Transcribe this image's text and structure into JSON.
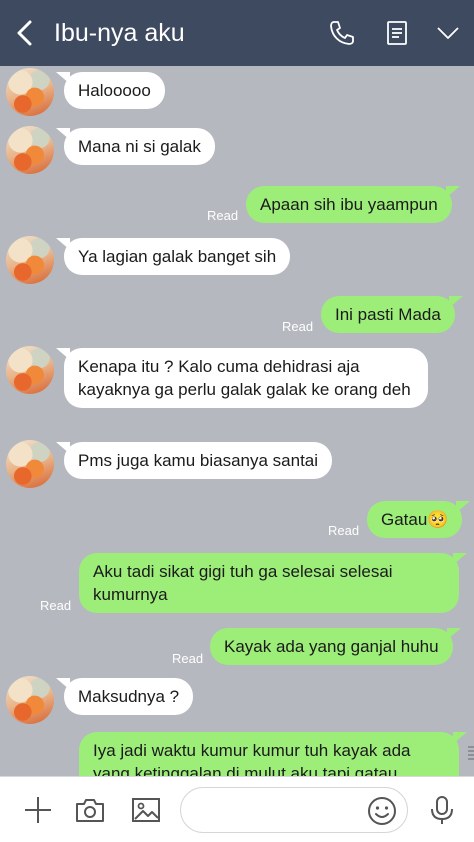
{
  "header": {
    "title": "Ibu-nya aku",
    "icons": [
      "back-arrow-icon",
      "phone-icon",
      "notes-icon",
      "chevron-down-icon"
    ],
    "background_color": "#3d4a5f"
  },
  "chat": {
    "background_color": "#b5b8bf",
    "incoming_bubble_color": "#ffffff",
    "outgoing_bubble_color": "#9ded79",
    "messages": [
      {
        "dir": "in",
        "text": "Halooooo"
      },
      {
        "dir": "in",
        "text": "Mana ni si galak"
      },
      {
        "dir": "out",
        "text": "Apaan sih ibu yaampun",
        "status": "Read"
      },
      {
        "dir": "in",
        "text": "Ya lagian galak banget sih"
      },
      {
        "dir": "out",
        "text": "Ini pasti Mada",
        "status": "Read"
      },
      {
        "dir": "in",
        "text": "Kenapa itu ? Kalo cuma dehidrasi aja kayaknya ga perlu galak galak ke orang deh"
      },
      {
        "dir": "in",
        "text": "Pms juga kamu biasanya santai"
      },
      {
        "dir": "out",
        "text": "Gatau",
        "emoji": "🥺",
        "status": "Read"
      },
      {
        "dir": "out",
        "text": "Aku tadi sikat gigi tuh ga selesai selesai kumurnya",
        "status": "Read"
      },
      {
        "dir": "out",
        "text": "Kayak ada yang ganjal huhu",
        "status": "Read"
      },
      {
        "dir": "in",
        "text": "Maksudnya ?"
      },
      {
        "dir": "out",
        "text": "Iya jadi waktu kumur kumur tuh kayak ada yang ketinggalan di mulut aku tapi gatau"
      }
    ]
  },
  "input_bar": {
    "icons": [
      "plus-icon",
      "camera-icon",
      "image-icon",
      "emoji-icon",
      "microphone-icon"
    ],
    "placeholder": ""
  }
}
